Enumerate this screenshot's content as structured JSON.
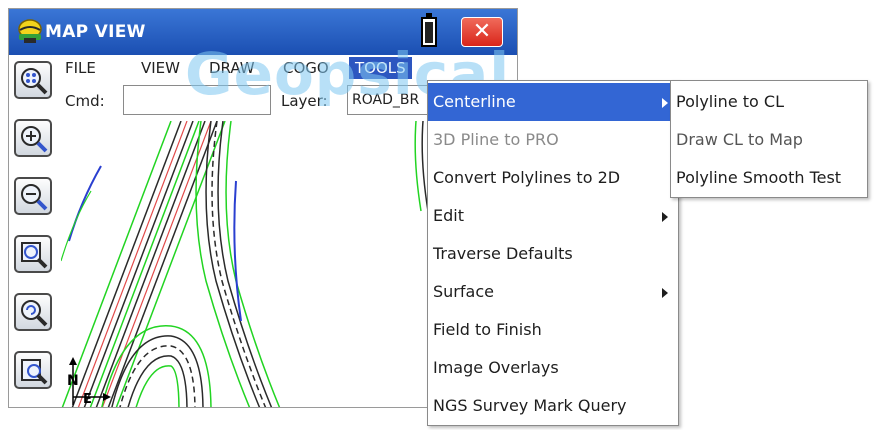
{
  "window": {
    "title": "MAP VIEW",
    "close_glyph": "✕"
  },
  "menubar": {
    "items": [
      "FILE",
      "VIEW",
      "DRAW",
      "COGO",
      "TOOLS"
    ],
    "active": "TOOLS"
  },
  "command": {
    "label": "Cmd:",
    "value": ""
  },
  "layer": {
    "label": "Layer:",
    "value": "ROAD_BR"
  },
  "watermark": "Geopsical",
  "toolbar": {
    "icons": [
      "zoom-extents-icon",
      "zoom-in-icon",
      "zoom-out-icon",
      "zoom-window-icon",
      "zoom-previous-icon",
      "map-options-icon"
    ]
  },
  "axes": {
    "north": "N",
    "east": "E"
  },
  "tools_menu": {
    "items": [
      {
        "label": "Centerline",
        "submenu": true,
        "highlighted": true,
        "enabled": true
      },
      {
        "label": "3D Pline to PRO",
        "submenu": false,
        "highlighted": false,
        "enabled": false
      },
      {
        "label": "Convert Polylines to 2D",
        "submenu": false,
        "highlighted": false,
        "enabled": true
      },
      {
        "label": "Edit",
        "submenu": true,
        "highlighted": false,
        "enabled": true
      },
      {
        "label": "Traverse Defaults",
        "submenu": false,
        "highlighted": false,
        "enabled": true
      },
      {
        "label": "Surface",
        "submenu": true,
        "highlighted": false,
        "enabled": true
      },
      {
        "label": "Field to Finish",
        "submenu": false,
        "highlighted": false,
        "enabled": true
      },
      {
        "label": "Image Overlays",
        "submenu": false,
        "highlighted": false,
        "enabled": true
      },
      {
        "label": "NGS Survey Mark Query",
        "submenu": false,
        "highlighted": false,
        "enabled": true
      }
    ]
  },
  "centerline_submenu": {
    "items": [
      {
        "label": "Polyline to CL",
        "enabled": true
      },
      {
        "label": "Draw CL to Map",
        "enabled": false
      },
      {
        "label": "Polyline Smooth Test",
        "enabled": true
      }
    ]
  },
  "colors": {
    "titlebar": "#2a62c8",
    "highlight": "#3366d4",
    "close": "#e0372a",
    "road_green": "#22d422",
    "road_blue": "#2a3fd0",
    "road_red": "#e24a4a"
  }
}
